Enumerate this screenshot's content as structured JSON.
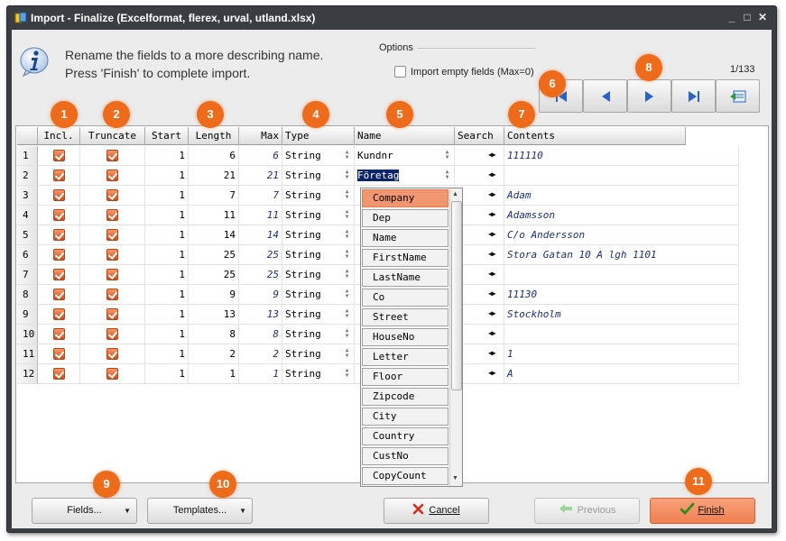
{
  "window": {
    "title": "Import - Finalize  (Excelformat, flerex, urval, utland.xlsx)",
    "controls": {
      "minimize": "_",
      "maximize": "□",
      "close": "✕"
    }
  },
  "info": {
    "line1": "Rename the fields to a more describing name.",
    "line2": "Press 'Finish' to complete import."
  },
  "options": {
    "label": "Options",
    "import_empty_label": "Import empty fields (Max=0)",
    "import_empty_checked": false
  },
  "pagination": {
    "text": "1/133"
  },
  "badges": [
    "1",
    "2",
    "3",
    "4",
    "5",
    "6",
    "7",
    "8",
    "9",
    "10",
    "11"
  ],
  "grid": {
    "headers": {
      "incl": "Incl.",
      "truncate": "Truncate",
      "start": "Start",
      "length": "Length",
      "max": "Max",
      "type": "Type",
      "name": "Name",
      "search": "Search",
      "contents": "Contents"
    },
    "rows": [
      {
        "n": "1",
        "start": "1",
        "length": "6",
        "max": "6",
        "type": "String",
        "name": "Kundnr",
        "contents": "111110"
      },
      {
        "n": "2",
        "start": "1",
        "length": "21",
        "max": "21",
        "type": "String",
        "name": "Företag",
        "contents": ""
      },
      {
        "n": "3",
        "start": "1",
        "length": "7",
        "max": "7",
        "type": "String",
        "name": "",
        "contents": "Adam"
      },
      {
        "n": "4",
        "start": "1",
        "length": "11",
        "max": "11",
        "type": "String",
        "name": "",
        "contents": "Adamsson"
      },
      {
        "n": "5",
        "start": "1",
        "length": "14",
        "max": "14",
        "type": "String",
        "name": "",
        "contents": "C/o Andersson"
      },
      {
        "n": "6",
        "start": "1",
        "length": "25",
        "max": "25",
        "type": "String",
        "name": "",
        "contents": "Stora Gatan 10 A lgh 1101"
      },
      {
        "n": "7",
        "start": "1",
        "length": "25",
        "max": "25",
        "type": "String",
        "name": "",
        "contents": ""
      },
      {
        "n": "8",
        "start": "1",
        "length": "9",
        "max": "9",
        "type": "String",
        "name": "",
        "contents": "11130"
      },
      {
        "n": "9",
        "start": "1",
        "length": "13",
        "max": "13",
        "type": "String",
        "name": "",
        "contents": "Stockholm"
      },
      {
        "n": "10",
        "start": "1",
        "length": "8",
        "max": "8",
        "type": "String",
        "name": "",
        "contents": ""
      },
      {
        "n": "11",
        "start": "1",
        "length": "2",
        "max": "2",
        "type": "String",
        "name": "",
        "contents": "1"
      },
      {
        "n": "12",
        "start": "1",
        "length": "1",
        "max": "1",
        "type": "String",
        "name": "",
        "contents": "A"
      }
    ],
    "editing_row": 2,
    "name_options": [
      "Company",
      "Dep",
      "Name",
      "FirstName",
      "LastName",
      "Co",
      "Street",
      "HouseNo",
      "Letter",
      "Floor",
      "Zipcode",
      "City",
      "Country",
      "CustNo",
      "CopyCount"
    ],
    "selected_option": "Company"
  },
  "buttons": {
    "fields": "Fields...",
    "templates": "Templates...",
    "cancel": "Cancel",
    "previous": "Previous",
    "finish": "Finish"
  },
  "colors": {
    "accent": "#ee6b1c",
    "selection": "#0a246a",
    "finish": "#f08555"
  }
}
